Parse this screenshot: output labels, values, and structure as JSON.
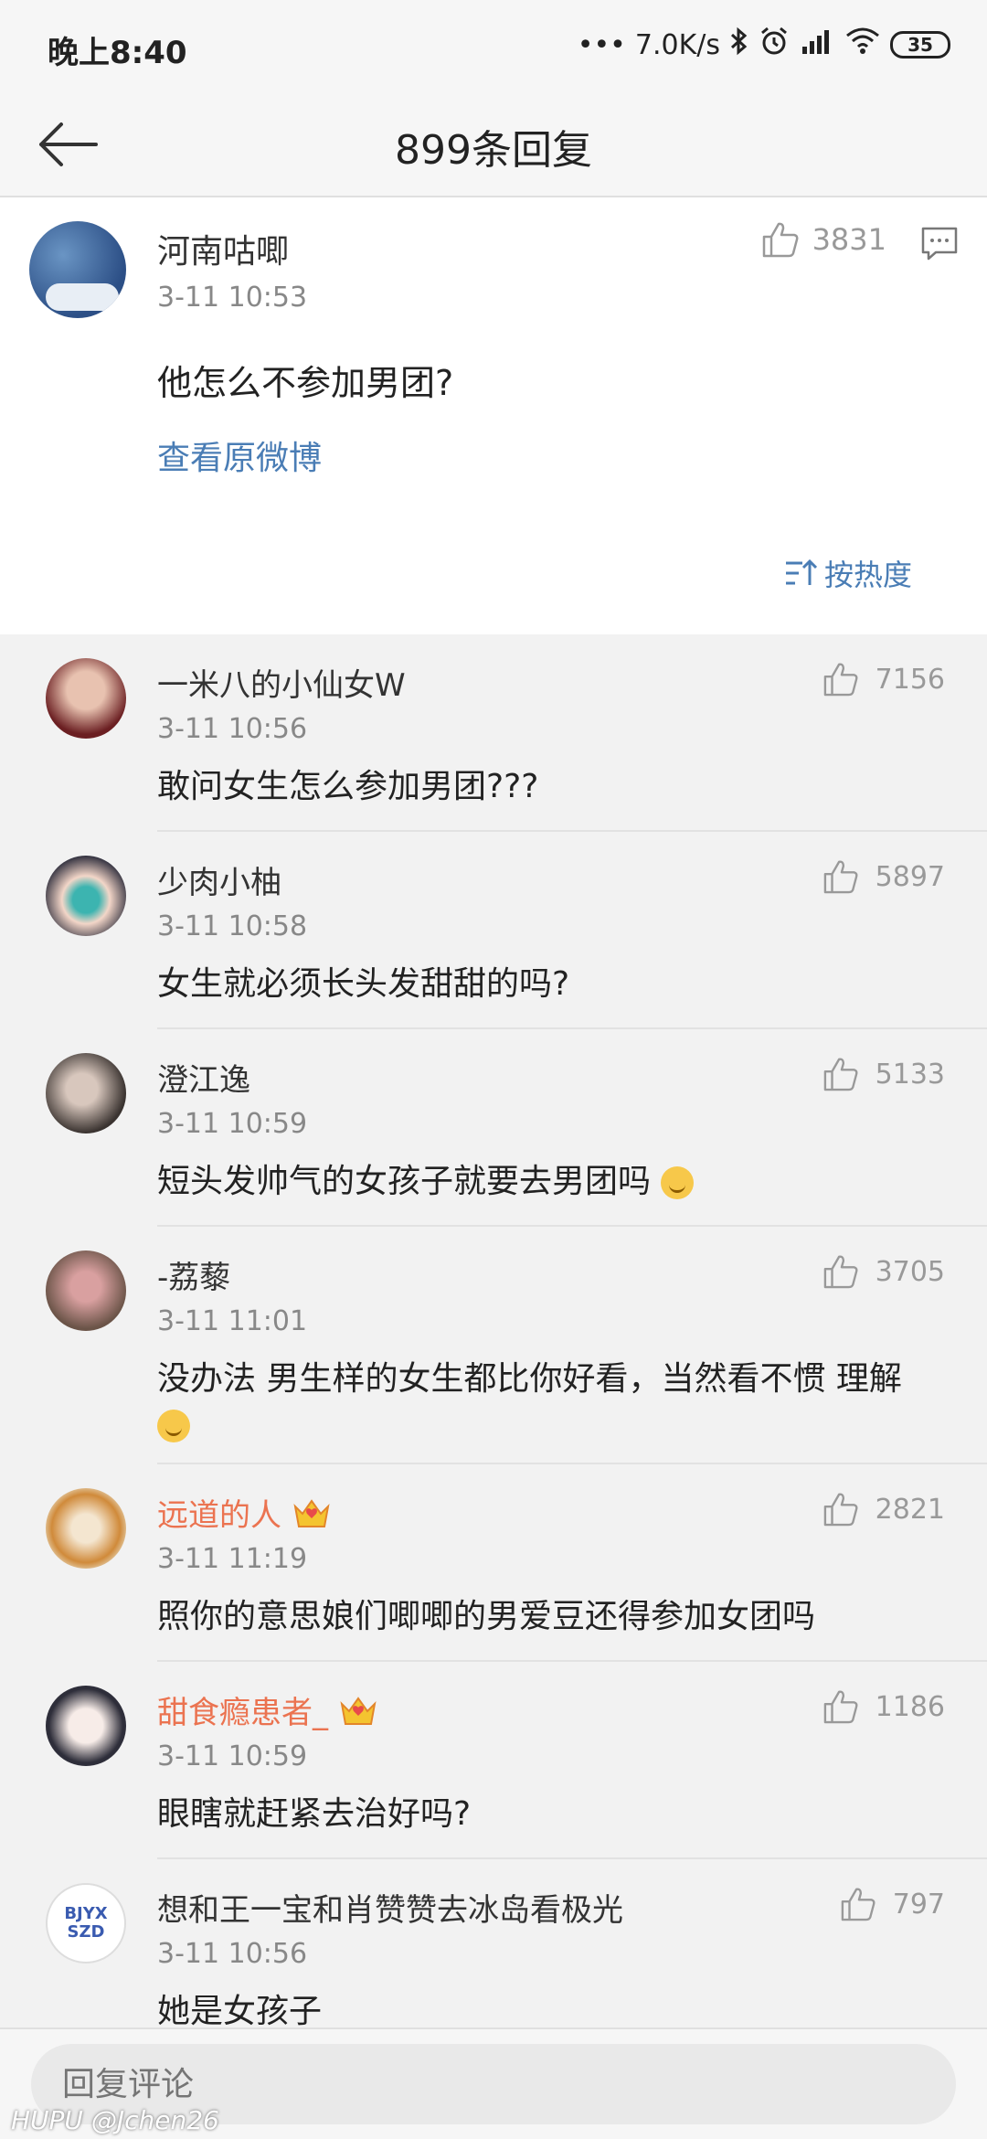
{
  "status_bar": {
    "time": "晚上8:40",
    "network_speed": "7.0K/s",
    "battery": "35"
  },
  "nav": {
    "title": "899条回复"
  },
  "main_comment": {
    "user": "河南咕唧",
    "time": "3-11 10:53",
    "text": "他怎么不参加男团?",
    "view_original": "查看原微博",
    "likes": "3831",
    "sort_label": "按热度"
  },
  "replies": [
    {
      "user": "一米八的小仙女W",
      "time": "3-11 10:56",
      "text": "敢问女生怎么参加男团???",
      "likes": "7156",
      "vip": false
    },
    {
      "user": "少肉小柚",
      "time": "3-11 10:58",
      "text": "女生就必须长头发甜甜的吗?",
      "likes": "5897",
      "vip": false
    },
    {
      "user": "澄江逸",
      "time": "3-11 10:59",
      "text": "短头发帅气的女孩子就要去男团吗",
      "likes": "5133",
      "vip": false
    },
    {
      "user": "-荔藜",
      "time": "3-11 11:01",
      "text": "没办法 男生样的女生都比你好看，当然看不惯 理解",
      "likes": "3705",
      "vip": false
    },
    {
      "user": "远道的人",
      "time": "3-11 11:19",
      "text": "照你的意思娘们唧唧的男爱豆还得参加女团吗",
      "likes": "2821",
      "vip": true
    },
    {
      "user": "甜食瘾患者_",
      "time": "3-11 10:59",
      "text": "眼瞎就赶紧去治好吗?",
      "likes": "1186",
      "vip": true
    },
    {
      "user": "想和王一宝和肖赞赞去冰岛看极光",
      "time": "3-11 10:56",
      "text": "她是女孩子",
      "likes": "797",
      "vip": false,
      "avatar_text": "BJYX SZD"
    }
  ],
  "bottom": {
    "placeholder": "回复评论"
  },
  "watermark": "HUPU @Jchen26",
  "colors": {
    "link_blue": "#4a7db5",
    "vip_orange": "#eb7350"
  }
}
